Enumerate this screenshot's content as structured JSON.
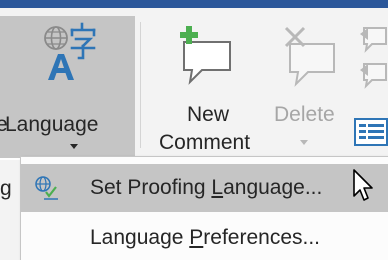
{
  "ribbon": {
    "language_button": {
      "label": "Language",
      "icon": "language-icon"
    },
    "new_comment_button": {
      "label_line1": "New",
      "label_line2": "Comment",
      "icon": "new-comment-icon"
    },
    "delete_button": {
      "label": "Delete",
      "icon": "delete-comment-icon",
      "state": "disabled"
    },
    "partial_left_text": "e",
    "partial_pane_text": "g"
  },
  "language_menu": {
    "items": [
      {
        "label_before": "Set Proofing ",
        "label_access": "L",
        "label_after": "anguage...",
        "icon": "proofing-language-icon",
        "highlighted": true
      },
      {
        "label_before": "Language ",
        "label_access": "P",
        "label_after": "references...",
        "icon": "",
        "highlighted": false
      }
    ]
  },
  "cursor": {
    "icon": "mouse-pointer-icon"
  },
  "colors": {
    "title_bar": "#2b579a",
    "ribbon_bg": "#f3f3f3",
    "pressed_bg": "#c5c5c5",
    "accent_blue": "#2e75b6",
    "comment_green": "#4caf50"
  }
}
